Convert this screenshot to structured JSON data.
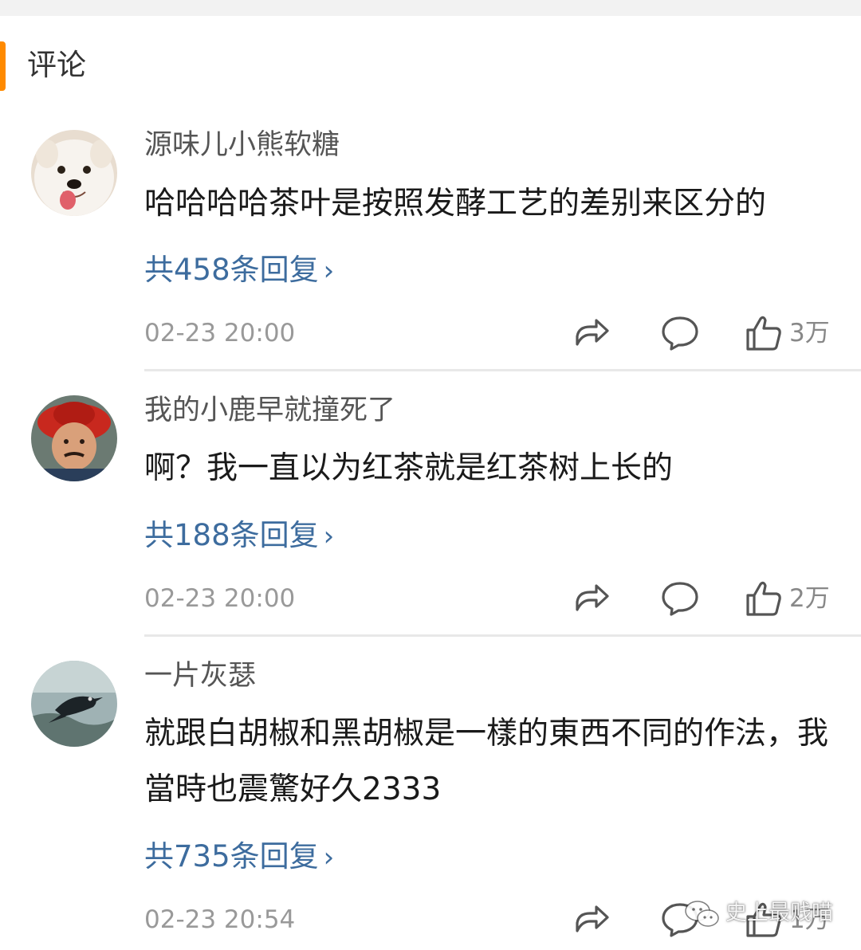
{
  "section": {
    "title": "评论"
  },
  "comments": [
    {
      "username": "源味儿小熊软糖",
      "text": "哈哈哈哈茶叶是按照发酵工艺的差别来区分的",
      "replies": "共458条回复",
      "time": "02-23 20:00",
      "likes": "3万",
      "avatar_icon": "dog-avatar-icon"
    },
    {
      "username": "我的小鹿早就撞死了",
      "text": "啊？我一直以为红茶就是红茶树上长的",
      "replies": "共188条回复",
      "time": "02-23 20:00",
      "likes": "2万",
      "avatar_icon": "man-red-hat-avatar-icon"
    },
    {
      "username": "一片灰瑟",
      "text": "就跟白胡椒和黑胡椒是一樣的東西不同的作法，我當時也震驚好久2333",
      "replies": "共735条回复",
      "time": "02-23 20:54",
      "likes": "1万",
      "avatar_icon": "crow-avatar-icon"
    }
  ],
  "watermark": {
    "text": "史上最贱喵",
    "icon": "wechat-icon"
  },
  "colors": {
    "accent": "#ff8a00",
    "link": "#3d6c9e",
    "text": "#1a1a1a",
    "meta": "#999999"
  }
}
